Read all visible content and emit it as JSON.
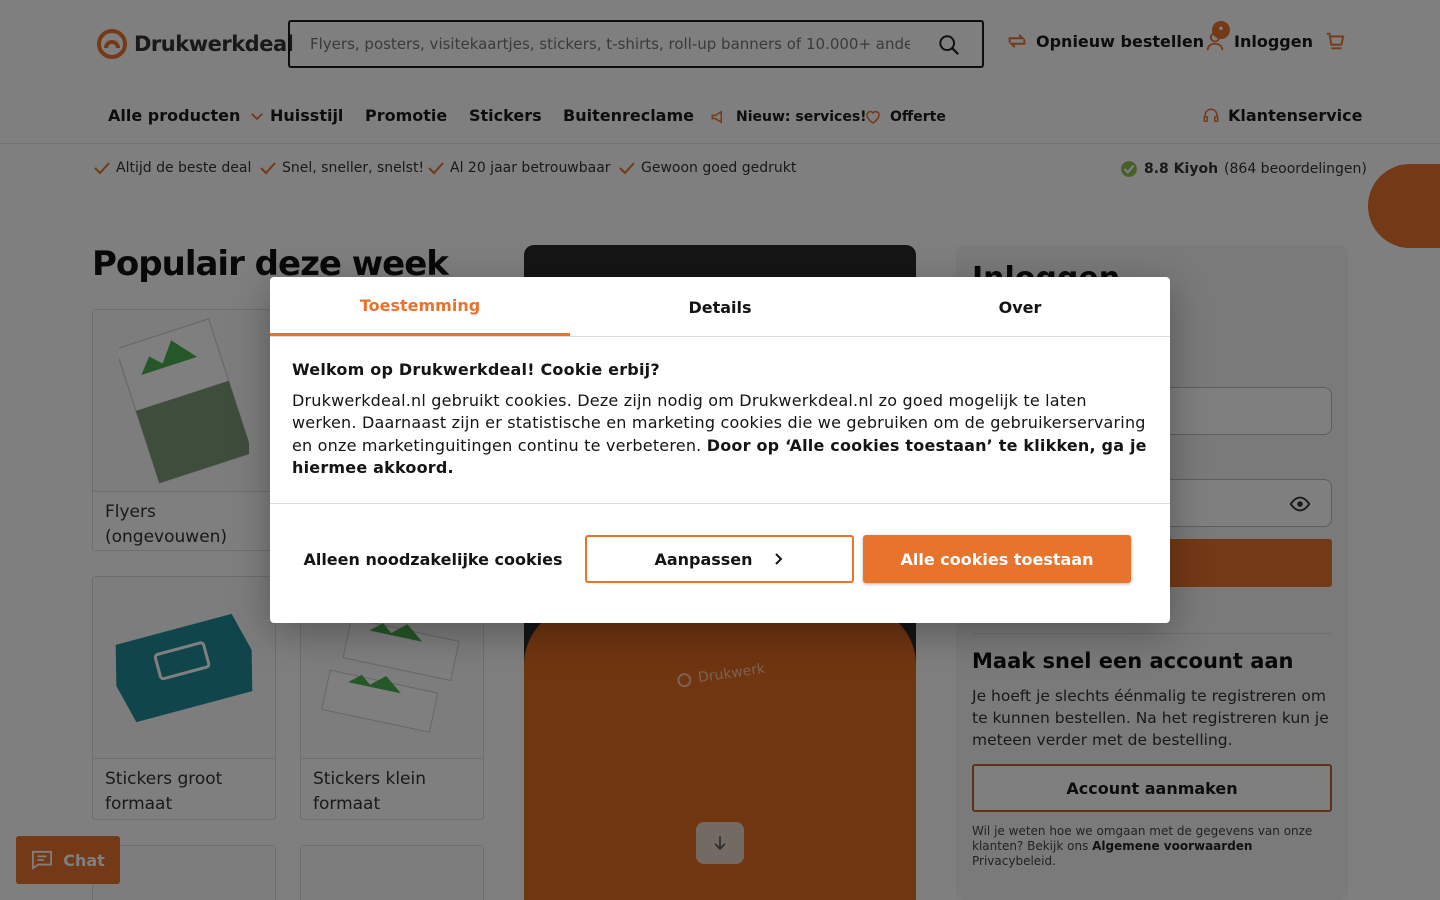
{
  "header": {
    "logo_text": "Drukwerkdeal",
    "search_placeholder": "Flyers, posters, visitekaartjes, stickers, t-shirts, roll-up banners of 10.000+ andere",
    "reorder_label": "Opnieuw bestellen",
    "login_label": "Inloggen",
    "cart_icon": "cart-icon",
    "accent_color": "#e8732d"
  },
  "nav": {
    "items": [
      {
        "label": "Alle producten"
      },
      {
        "label": "Huisstijl"
      },
      {
        "label": "Promotie"
      },
      {
        "label": "Stickers"
      },
      {
        "label": "Buitenreclame"
      }
    ],
    "news_label": "Nieuw: services!",
    "quote_label": "Offerte",
    "service_label": "Klantenservice"
  },
  "usps": {
    "items": [
      "Altijd de beste deal",
      "Snel, sneller, snelst!",
      "Al 20 jaar betrouwbaar",
      "Gewoon goed gedrukt"
    ],
    "rating_score": "8.8 Kiyoh",
    "rating_count": "(864 beoordelingen)"
  },
  "popular": {
    "title": "Populair deze week",
    "products": [
      {
        "label": "Flyers (ongevouwen)"
      },
      {
        "label": "Stickers groot formaat"
      },
      {
        "label": "Stickers klein formaat"
      }
    ]
  },
  "login_panel": {
    "title": "Inloggen",
    "account_title": "Maak snel een account aan",
    "account_text": "Je hoeft je slechts éénmalig te registreren om te kunnen bestellen. Na het registreren kun je meteen verder met de bestelling.",
    "account_button": "Account aanmaken",
    "note_prefix": "Wil je weten hoe we omgaan met de gegevens van onze klanten? Bekijk ons ",
    "note_terms": "Algemene voorwaarden",
    "note_privacy": " Privacybeleid."
  },
  "hero": {
    "brand": "Drukwerk"
  },
  "chat": {
    "label": "Chat"
  },
  "cookie_dialog": {
    "tabs": [
      {
        "label": "Toestemming",
        "active": true
      },
      {
        "label": "Details",
        "active": false
      },
      {
        "label": "Over",
        "active": false
      }
    ],
    "heading": "Welkom op Drukwerkdeal! Cookie erbij?",
    "body": "Drukwerkdeal.nl gebruikt cookies. Deze zijn nodig om Drukwerkdeal.nl zo goed mogelijk te laten werken. Daarnaast zijn er statistische en marketing cookies die we gebruiken om de gebruikerservaring en onze marketinguitingen continu te verbeteren. ",
    "body_bold": "Door op ‘Alle cookies toestaan’ te klikken, ga je hiermee akkoord.",
    "btn_necessary": "Alleen noodzakelijke cookies",
    "btn_customize": "Aanpassen",
    "btn_all": "Alle cookies toestaan"
  }
}
